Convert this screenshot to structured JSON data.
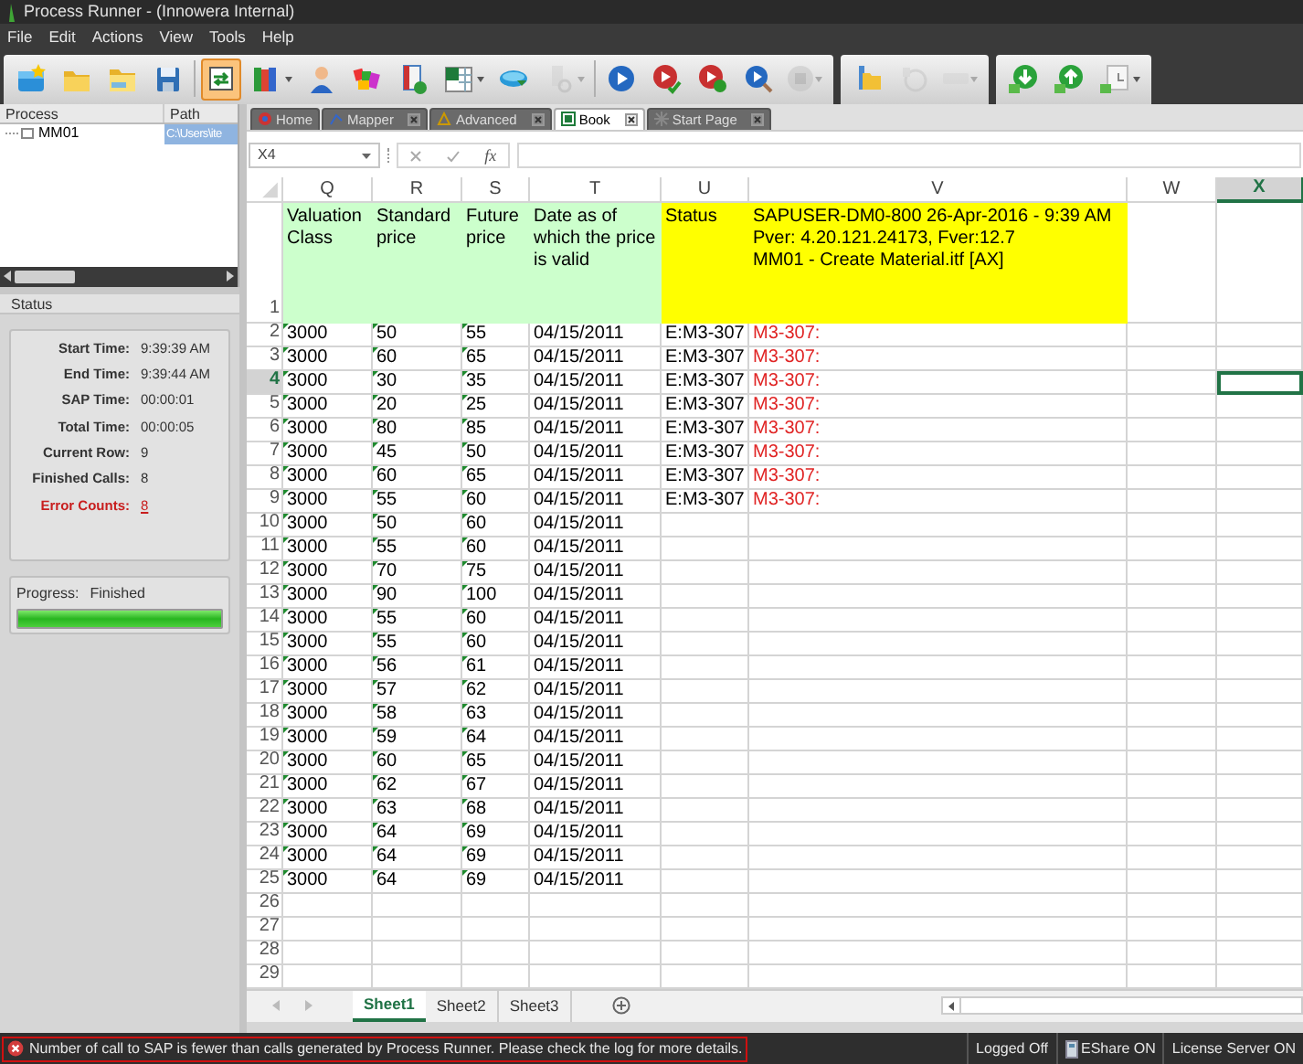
{
  "window": {
    "title": "Process Runner - (Innowera Internal)"
  },
  "menu": [
    "File",
    "Edit",
    "Actions",
    "View",
    "Tools",
    "Help"
  ],
  "toolbar": {
    "groups": [
      {
        "buttons": [
          {
            "selected": false,
            "disabled": false,
            "menu": false
          },
          {
            "selected": false,
            "disabled": false,
            "menu": false
          },
          {
            "selected": false,
            "disabled": false,
            "menu": false
          },
          {
            "selected": false,
            "disabled": false,
            "menu": false
          },
          {
            "selected": true,
            "disabled": false,
            "menu": false
          },
          {
            "selected": false,
            "disabled": false,
            "menu": true
          },
          {
            "selected": false,
            "disabled": false,
            "menu": false
          },
          {
            "selected": false,
            "disabled": false,
            "menu": false
          },
          {
            "selected": false,
            "disabled": false,
            "menu": false
          },
          {
            "selected": false,
            "disabled": false,
            "menu": true
          },
          {
            "selected": false,
            "disabled": false,
            "menu": false
          },
          {
            "selected": false,
            "disabled": true,
            "menu": true
          },
          {
            "selected": false,
            "disabled": false,
            "menu": false
          },
          {
            "selected": false,
            "disabled": false,
            "menu": false
          },
          {
            "selected": false,
            "disabled": false,
            "menu": false
          },
          {
            "selected": false,
            "disabled": false,
            "menu": false
          },
          {
            "selected": false,
            "disabled": true,
            "menu": true
          }
        ]
      },
      {
        "buttons": [
          {
            "selected": false,
            "disabled": false,
            "menu": false
          },
          {
            "selected": false,
            "disabled": true,
            "menu": false
          },
          {
            "selected": false,
            "disabled": true,
            "menu": true
          }
        ]
      },
      {
        "buttons": [
          {
            "selected": false,
            "disabled": false,
            "menu": false
          },
          {
            "selected": false,
            "disabled": false,
            "menu": false
          },
          {
            "selected": false,
            "disabled": false,
            "menu": true
          }
        ]
      }
    ]
  },
  "process_panel": {
    "columns": [
      "Process",
      "Path"
    ],
    "rows": [
      {
        "process": "MM01",
        "path": "C:\\Users\\ite",
        "selected": true
      }
    ]
  },
  "status_panel": {
    "title": "Status",
    "stats": [
      {
        "label": "Start Time:",
        "value": "9:39:39 AM",
        "kind": "normal"
      },
      {
        "label": "End Time:",
        "value": "9:39:44 AM",
        "kind": "normal"
      },
      {
        "label": "SAP Time:",
        "value": "00:00:01",
        "kind": "normal"
      },
      {
        "label": "Total Time:",
        "value": "00:00:05",
        "kind": "normal"
      },
      {
        "label": "Current Row:",
        "value": "9",
        "kind": "normal"
      },
      {
        "label": "Finished Calls:",
        "value": "8",
        "kind": "normal"
      },
      {
        "label": "Error Counts:",
        "value": "8",
        "kind": "error"
      }
    ],
    "progress": {
      "label": "Progress:",
      "value": "Finished",
      "level": 1
    }
  },
  "doc_tabs": [
    {
      "label": "Home",
      "closable": false,
      "selected": false
    },
    {
      "label": "Mapper",
      "closable": true,
      "selected": false
    },
    {
      "label": "Advanced",
      "closable": true,
      "selected": false
    },
    {
      "label": "Book",
      "closable": true,
      "selected": true
    },
    {
      "label": "Start Page",
      "closable": true,
      "selected": false
    }
  ],
  "formula_bar": {
    "name_box": "X4",
    "function_label": "fx"
  },
  "sheet": {
    "columns": [
      {
        "letter": "Q",
        "header": "Valuation Class",
        "color": "#ccffcc",
        "kind": "flagged",
        "selected": false
      },
      {
        "letter": "R",
        "header": "Standard price",
        "color": "#ccffcc",
        "kind": "flagged",
        "selected": false
      },
      {
        "letter": "S",
        "header": "Future price",
        "color": "#ccffcc",
        "kind": "flagged",
        "selected": false
      },
      {
        "letter": "T",
        "header": "Date as of which the price is valid",
        "color": "#ccffcc",
        "kind": "plain",
        "selected": false
      },
      {
        "letter": "U",
        "header": "Status",
        "color": "#ffff00",
        "kind": "plain",
        "selected": false
      },
      {
        "letter": "V",
        "header": "SAPUSER-DM0-800 26-Apr-2016 - 9:39 AM\nPver: 4.20.121.24173, Fver:12.7\nMM01 - Create Material.itf [AX]",
        "color": "#ffff00",
        "kind": "message",
        "selected": false
      },
      {
        "letter": "W",
        "selected": false
      },
      {
        "letter": "X",
        "selected": true
      }
    ],
    "header_row": {
      "number": "1",
      "selected": false
    },
    "rows": [
      {
        "number": "2",
        "selected": false,
        "cells": [
          "3000",
          "50",
          "55",
          "04/15/2011",
          "E:M3-307",
          "M3-307:"
        ]
      },
      {
        "number": "3",
        "selected": false,
        "cells": [
          "3000",
          "60",
          "65",
          "04/15/2011",
          "E:M3-307",
          "M3-307:"
        ]
      },
      {
        "number": "4",
        "selected": true,
        "cells": [
          "3000",
          "30",
          "35",
          "04/15/2011",
          "E:M3-307",
          "M3-307:"
        ]
      },
      {
        "number": "5",
        "selected": false,
        "cells": [
          "3000",
          "20",
          "25",
          "04/15/2011",
          "E:M3-307",
          "M3-307:"
        ]
      },
      {
        "number": "6",
        "selected": false,
        "cells": [
          "3000",
          "80",
          "85",
          "04/15/2011",
          "E:M3-307",
          "M3-307:"
        ]
      },
      {
        "number": "7",
        "selected": false,
        "cells": [
          "3000",
          "45",
          "50",
          "04/15/2011",
          "E:M3-307",
          "M3-307:"
        ]
      },
      {
        "number": "8",
        "selected": false,
        "cells": [
          "3000",
          "60",
          "65",
          "04/15/2011",
          "E:M3-307",
          "M3-307:"
        ]
      },
      {
        "number": "9",
        "selected": false,
        "cells": [
          "3000",
          "55",
          "60",
          "04/15/2011",
          "E:M3-307",
          "M3-307:"
        ]
      },
      {
        "number": "10",
        "selected": false,
        "cells": [
          "3000",
          "50",
          "60",
          "04/15/2011"
        ]
      },
      {
        "number": "11",
        "selected": false,
        "cells": [
          "3000",
          "55",
          "60",
          "04/15/2011"
        ]
      },
      {
        "number": "12",
        "selected": false,
        "cells": [
          "3000",
          "70",
          "75",
          "04/15/2011"
        ]
      },
      {
        "number": "13",
        "selected": false,
        "cells": [
          "3000",
          "90",
          "100",
          "04/15/2011"
        ]
      },
      {
        "number": "14",
        "selected": false,
        "cells": [
          "3000",
          "55",
          "60",
          "04/15/2011"
        ]
      },
      {
        "number": "15",
        "selected": false,
        "cells": [
          "3000",
          "55",
          "60",
          "04/15/2011"
        ]
      },
      {
        "number": "16",
        "selected": false,
        "cells": [
          "3000",
          "56",
          "61",
          "04/15/2011"
        ]
      },
      {
        "number": "17",
        "selected": false,
        "cells": [
          "3000",
          "57",
          "62",
          "04/15/2011"
        ]
      },
      {
        "number": "18",
        "selected": false,
        "cells": [
          "3000",
          "58",
          "63",
          "04/15/2011"
        ]
      },
      {
        "number": "19",
        "selected": false,
        "cells": [
          "3000",
          "59",
          "64",
          "04/15/2011"
        ]
      },
      {
        "number": "20",
        "selected": false,
        "cells": [
          "3000",
          "60",
          "65",
          "04/15/2011"
        ]
      },
      {
        "number": "21",
        "selected": false,
        "cells": [
          "3000",
          "62",
          "67",
          "04/15/2011"
        ]
      },
      {
        "number": "22",
        "selected": false,
        "cells": [
          "3000",
          "63",
          "68",
          "04/15/2011"
        ]
      },
      {
        "number": "23",
        "selected": false,
        "cells": [
          "3000",
          "64",
          "69",
          "04/15/2011"
        ]
      },
      {
        "number": "24",
        "selected": false,
        "cells": [
          "3000",
          "64",
          "69",
          "04/15/2011"
        ]
      },
      {
        "number": "25",
        "selected": false,
        "cells": [
          "3000",
          "64",
          "69",
          "04/15/2011"
        ]
      },
      {
        "number": "26",
        "selected": false,
        "cells": []
      },
      {
        "number": "27",
        "selected": false,
        "cells": []
      },
      {
        "number": "28",
        "selected": false,
        "cells": []
      },
      {
        "number": "29",
        "selected": false,
        "cells": []
      }
    ]
  },
  "sheet_tabs": [
    {
      "label": "Sheet1",
      "selected": true
    },
    {
      "label": "Sheet2",
      "selected": false
    },
    {
      "label": "Sheet3",
      "selected": false
    }
  ],
  "status_bar": {
    "message": "Number of call to SAP is fewer than calls generated by Process Runner. Please check the log for more details.",
    "items": [
      {
        "label": "Logged Off",
        "kind": "text"
      },
      {
        "label": "EShare ON",
        "kind": "icon"
      },
      {
        "label": "License Server ON",
        "kind": "text"
      }
    ]
  }
}
